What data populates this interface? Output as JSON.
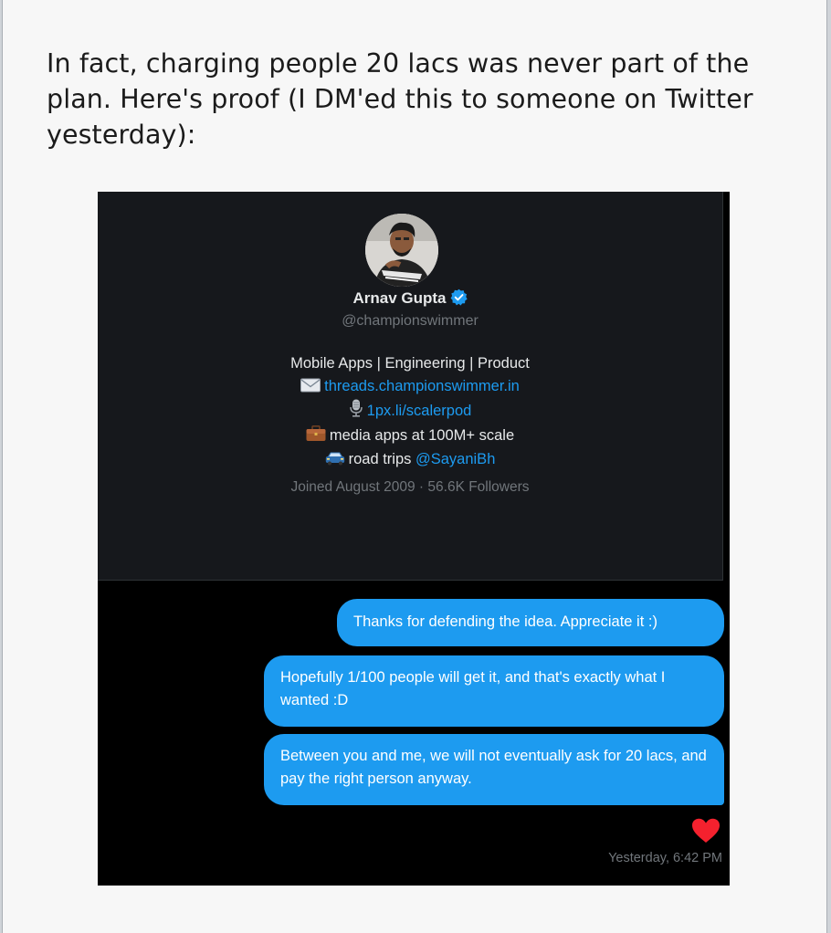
{
  "post": {
    "intro_text": "In fact, charging people 20 lacs was never part of the plan. Here's proof (I DM'ed this to someone on Twitter yesterday):"
  },
  "profile": {
    "name": "Arnav Gupta",
    "handle": "@championswimmer",
    "bio_line1": "Mobile Apps | Engineering | Product",
    "bio_link1": "threads.championswimmer.in",
    "bio_link2": "1px.li/scalerpod",
    "bio_line4": "media apps at 100M+ scale",
    "bio_line5_text": "road trips ",
    "bio_line5_mention": "@SayaniBh",
    "joined": "Joined August 2009 · 56.6K Followers",
    "icons": [
      "verified-badge-icon",
      "envelope-icon",
      "microphone-icon",
      "briefcase-icon",
      "car-icon"
    ]
  },
  "messages": [
    {
      "text": "Thanks for defending the idea. Appreciate it :)"
    },
    {
      "text": "Hopefully 1/100 people will get it, and that's exactly what I wanted :D"
    },
    {
      "text": "Between you and me, we will not eventually ask for 20 lacs, and pay the right person anyway."
    }
  ],
  "reaction": "heart-icon",
  "timestamp": "Yesterday, 6:42 PM",
  "colors": {
    "twitter_blue": "#1d9bf0",
    "card_bg": "#16181c",
    "muted_text": "#71767b",
    "heart_red": "#f4212e"
  }
}
